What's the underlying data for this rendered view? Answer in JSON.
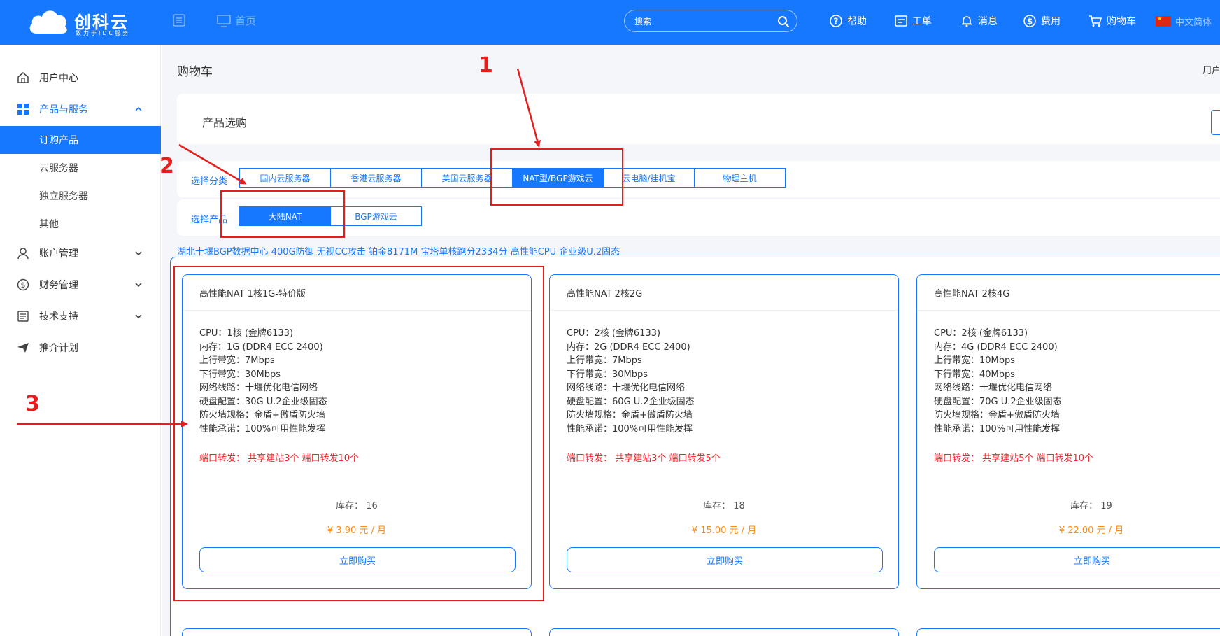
{
  "header": {
    "brand": "创科云",
    "slogan": "致力于IDC服务",
    "home": "首页",
    "search_placeholder": "搜索",
    "nav": {
      "help": "帮助",
      "ticket": "工单",
      "message": "消息",
      "billing": "费用",
      "cart": "购物车",
      "language": "中文简体"
    }
  },
  "sidebar": {
    "user_center": "用户中心",
    "products_services": "产品与服务",
    "sub": {
      "order": "订购产品",
      "cloud": "云服务器",
      "dedicated": "独立服务器",
      "other": "其他"
    },
    "account": "账户管理",
    "finance": "财务管理",
    "support": "技术支持",
    "referral": "推介计划"
  },
  "page": {
    "title": "购物车",
    "crumb": "用户中心",
    "panel_title": "产品选购",
    "category_label": "选择分类",
    "product_label": "选择产品",
    "promo": "湖北十堰BGP数据中心 400G防御 无视CC攻击 铂金8171M 宝塔单核跑分2334分 高性能CPU 企业级U.2固态"
  },
  "categories": [
    "国内云服务器",
    "香港云服务器",
    "美国云服务器",
    "NAT型/BGP游戏云",
    "云电脑/挂机宝",
    "物理主机"
  ],
  "active_category": 3,
  "products": [
    "大陆NAT",
    "BGP游戏云"
  ],
  "active_product": 0,
  "plans": [
    {
      "name": "高性能NAT 1核1G-特价版",
      "specs": [
        "CPU：1核 (金牌6133)",
        "内存：1G (DDR4 ECC 2400)",
        "上行带宽：7Mbps",
        "下行带宽：30Mbps",
        "网络线路：十堰优化电信网络",
        "硬盘配置：30G U.2企业级固态",
        "防火墙规格：金盾+傲盾防火墙",
        "性能承诺：100%可用性能发挥"
      ],
      "ports": "端口转发： 共享建站3个 端口转发10个",
      "stock": "库存： 16",
      "price": "¥ 3.90 元 / 月",
      "buy": "立即购买"
    },
    {
      "name": "高性能NAT 2核2G",
      "specs": [
        "CPU：2核 (金牌6133)",
        "内存：2G (DDR4 ECC 2400)",
        "上行带宽：7Mbps",
        "下行带宽：30Mbps",
        "网络线路：十堰优化电信网络",
        "硬盘配置：60G U.2企业级固态",
        "防火墙规格：金盾+傲盾防火墙",
        "性能承诺：100%可用性能发挥"
      ],
      "ports": "端口转发： 共享建站3个 端口转发5个",
      "stock": "库存： 18",
      "price": "¥ 15.00 元 / 月",
      "buy": "立即购买"
    },
    {
      "name": "高性能NAT 2核4G",
      "specs": [
        "CPU：2核 (金牌6133)",
        "内存：4G (DDR4 ECC 2400)",
        "上行带宽：10Mbps",
        "下行带宽：40Mbps",
        "网络线路：十堰优化电信网络",
        "硬盘配置：70G U.2企业级固态",
        "防火墙规格：金盾+傲盾防火墙",
        "性能承诺：100%可用性能发挥"
      ],
      "ports": "端口转发： 共享建站5个 端口转发10个",
      "stock": "库存： 19",
      "price": "¥ 22.00 元 / 月",
      "buy": "立即购买"
    }
  ],
  "annotations": {
    "color": "#e51d1d",
    "labels": [
      "1",
      "2",
      "3"
    ]
  },
  "colors": {
    "primary": "#1677ff",
    "price": "#fa8c16",
    "ports": "#f5222d"
  }
}
